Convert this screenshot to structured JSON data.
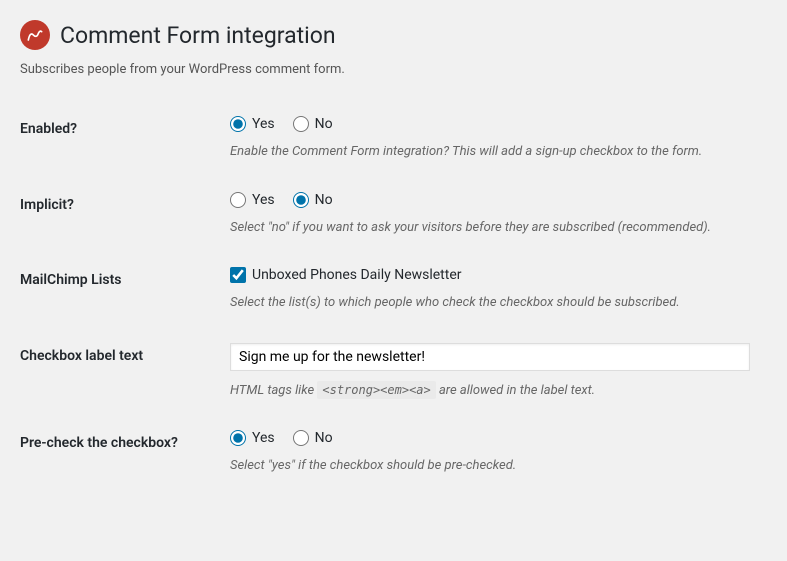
{
  "header": {
    "title": "Comment Form integration"
  },
  "subtitle": "Subscribes people from your WordPress comment form.",
  "fields": {
    "enabled": {
      "label": "Enabled?",
      "yes": "Yes",
      "no": "No",
      "value": "yes",
      "description": "Enable the Comment Form integration? This will add a sign-up checkbox to the form."
    },
    "implicit": {
      "label": "Implicit?",
      "yes": "Yes",
      "no": "No",
      "value": "no",
      "description": "Select \"no\" if you want to ask your visitors before they are subscribed (recommended)."
    },
    "lists": {
      "label": "MailChimp Lists",
      "items": [
        {
          "label": "Unboxed Phones Daily Newsletter",
          "checked": true
        }
      ],
      "description": "Select the list(s) to which people who check the checkbox should be subscribed."
    },
    "checkbox_text": {
      "label": "Checkbox label text",
      "value": "Sign me up for the newsletter!",
      "desc_before": "HTML tags like ",
      "desc_code": "<strong><em><a>",
      "desc_after": " are allowed in the label text."
    },
    "precheck": {
      "label": "Pre-check the checkbox?",
      "yes": "Yes",
      "no": "No",
      "value": "yes",
      "description": "Select \"yes\" if the checkbox should be pre-checked."
    }
  }
}
